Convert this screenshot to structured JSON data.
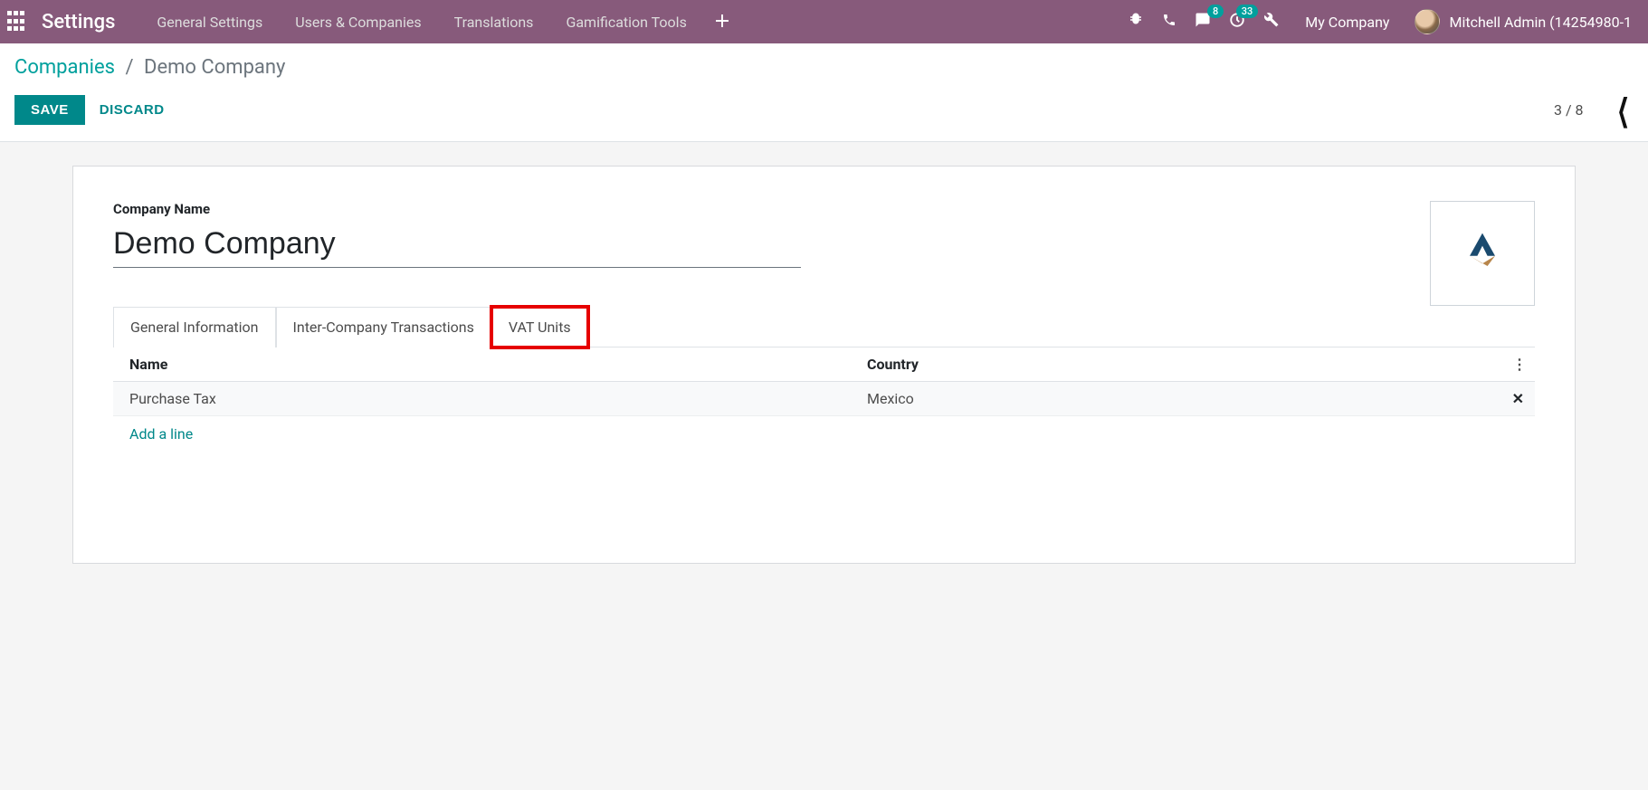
{
  "navbar": {
    "brand": "Settings",
    "links": [
      "General Settings",
      "Users & Companies",
      "Translations",
      "Gamification Tools"
    ],
    "messages_badge": "8",
    "activities_badge": "33",
    "company": "My Company",
    "user": "Mitchell Admin (14254980-1"
  },
  "breadcrumb": {
    "parent": "Companies",
    "current": "Demo Company"
  },
  "actions": {
    "save": "SAVE",
    "discard": "DISCARD",
    "pager": "3 / 8"
  },
  "form": {
    "company_name_label": "Company Name",
    "company_name_value": "Demo Company",
    "tabs": [
      "General Information",
      "Inter-Company Transactions",
      "VAT Units"
    ],
    "active_tab_index": 2
  },
  "vat_table": {
    "headers": {
      "name": "Name",
      "country": "Country"
    },
    "rows": [
      {
        "name": "Purchase Tax",
        "country": "Mexico"
      }
    ],
    "add_line": "Add a line"
  }
}
